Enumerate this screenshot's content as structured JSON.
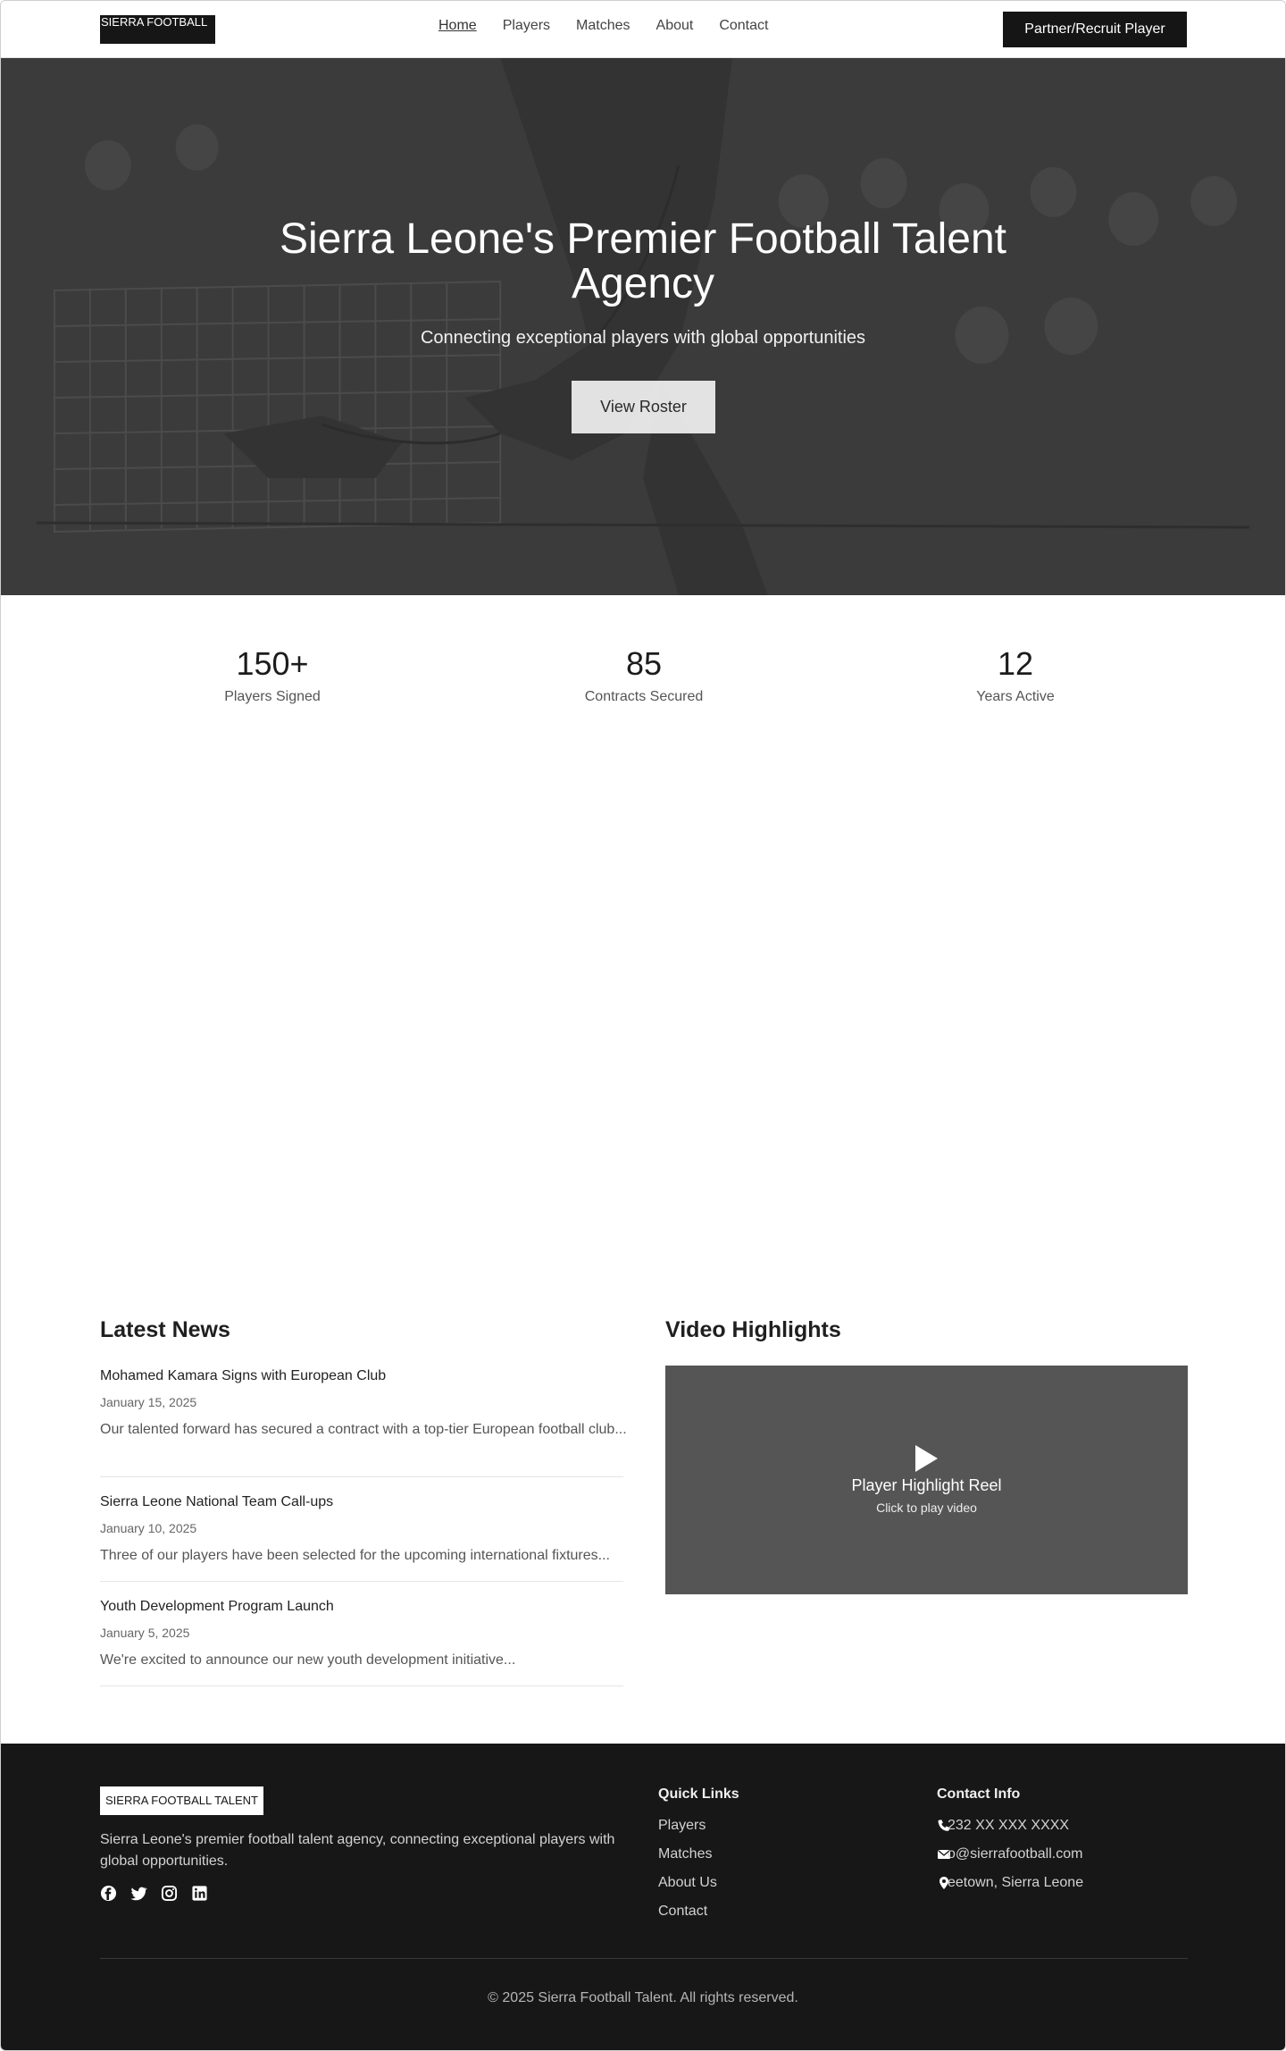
{
  "nav": {
    "logo": "SIERRA FOOTBALL",
    "links": [
      "Home",
      "Players",
      "Matches",
      "About",
      "Contact"
    ],
    "cta": "Partner/Recruit Player"
  },
  "hero": {
    "title": "Sierra Leone's Premier Football Talent Agency",
    "subtitle": "Connecting exceptional players with global opportunities",
    "button": "View Roster"
  },
  "stats": [
    {
      "value": "150+",
      "label": "Players Signed"
    },
    {
      "value": "85",
      "label": "Contracts Secured"
    },
    {
      "value": "12",
      "label": "Years Active"
    }
  ],
  "news": {
    "heading": "Latest News",
    "items": [
      {
        "title": "Mohamed Kamara Signs with European Club",
        "date": "January 15, 2025",
        "excerpt": "Our talented forward has secured a contract with a top-tier European football club..."
      },
      {
        "title": "Sierra Leone National Team Call-ups",
        "date": "January 10, 2025",
        "excerpt": "Three of our players have been selected for the upcoming international fixtures..."
      },
      {
        "title": "Youth Development Program Launch",
        "date": "January 5, 2025",
        "excerpt": "We're excited to announce our new youth development initiative..."
      }
    ]
  },
  "video": {
    "heading": "Video Highlights",
    "title": "Player Highlight Reel",
    "subtitle": "Click to play video",
    "icon": "play-icon"
  },
  "footer": {
    "logo": "SIERRA FOOTBALL TALENT",
    "description": "Sierra Leone's premier football talent agency, connecting exceptional players with global opportunities.",
    "socials": [
      "facebook-icon",
      "twitter-icon",
      "instagram-icon",
      "linkedin-icon"
    ],
    "quick_links_heading": "Quick Links",
    "quick_links": [
      "Players",
      "Matches",
      "About Us",
      "Contact"
    ],
    "contact_heading": "Contact Info",
    "contact": {
      "phone": "232 XX XXX XXXX",
      "email": "o@sierrafootball.com",
      "address": "eetown, Sierra Leone"
    },
    "copyright": "© 2025 Sierra Football Talent. All rights reserved."
  },
  "colors": {
    "dark": "#171717",
    "hero_overlay": "#3a3a3a",
    "video_bg": "#555555"
  }
}
